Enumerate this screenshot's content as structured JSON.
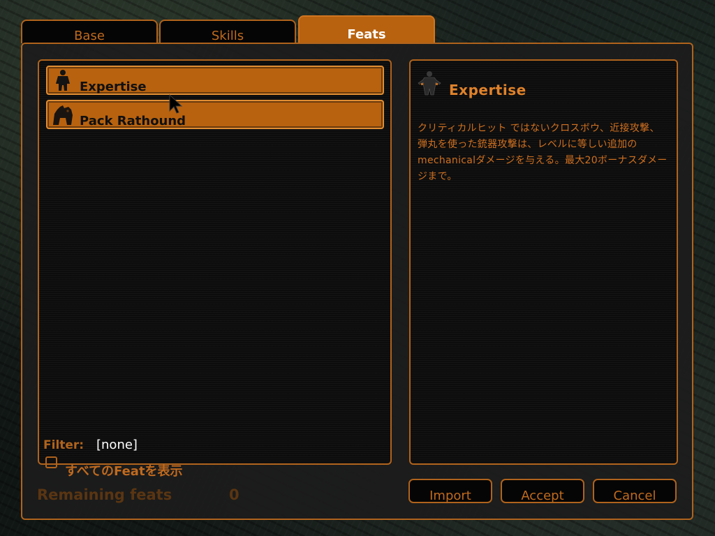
{
  "tabs": [
    {
      "label": "Base",
      "active": false
    },
    {
      "label": "Skills",
      "active": false
    },
    {
      "label": "Feats",
      "active": true
    }
  ],
  "feat_list": {
    "items": [
      {
        "label": "Expertise",
        "icon": "figure-icon"
      },
      {
        "label": "Pack Rathound",
        "icon": "rathound-icon"
      }
    ]
  },
  "filter": {
    "label": "Filter:",
    "value": "[none]",
    "show_all_label": "すべてのFeatを表示",
    "show_all_checked": false
  },
  "detail": {
    "title": "Expertise",
    "icon": "figure-icon",
    "description": "クリティカルヒット ではないクロスボウ、近接攻撃、弾丸を使った銃器攻撃は、レベルに等しい追加のmechanicalダメージを与える。最大20ボーナスダメージまで。"
  },
  "remaining": {
    "label": "Remaining feats",
    "value": "0"
  },
  "buttons": {
    "import": "Import",
    "accept": "Accept",
    "cancel": "Cancel"
  },
  "colors": {
    "accent": "#b8620f",
    "border": "#b0631c",
    "text_orange": "#d07020",
    "dim_text": "#5a3512"
  }
}
